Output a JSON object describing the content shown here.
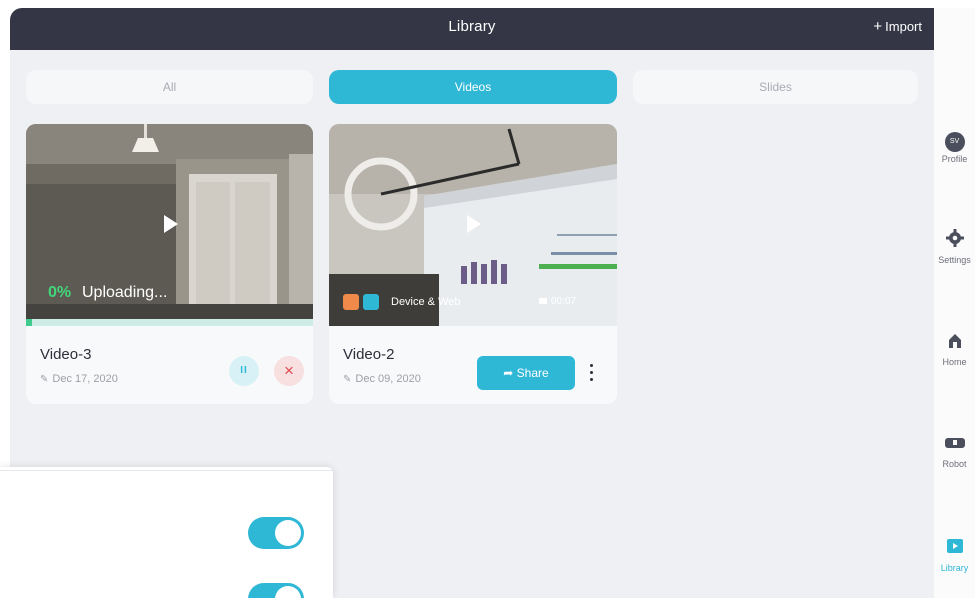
{
  "header": {
    "title": "Library",
    "import_label": "Import"
  },
  "tabs": [
    {
      "label": "All",
      "active": false
    },
    {
      "label": "Videos",
      "active": true
    },
    {
      "label": "Slides",
      "active": false
    }
  ],
  "videos": [
    {
      "name": "Video-3",
      "date": "Dec 17, 2020",
      "upload_percent": "0%",
      "upload_status": "Uploading...",
      "progress": 0.02
    },
    {
      "name": "Video-2",
      "date": "Dec 09, 2020",
      "source": "Device & Web",
      "duration": "00:07",
      "share_label": "Share"
    }
  ],
  "nav": [
    {
      "label": "Profile",
      "icon": "avatar",
      "initials": "SV"
    },
    {
      "label": "Settings",
      "icon": "gear-icon"
    },
    {
      "label": "Home",
      "icon": "home-icon"
    },
    {
      "label": "Robot",
      "icon": "robot-icon"
    },
    {
      "label": "Library",
      "icon": "library-icon",
      "active": true
    }
  ],
  "panel": {
    "toggles": [
      true,
      true
    ]
  },
  "colors": {
    "accent": "#2fb7d6",
    "header": "#343645",
    "danger": "#e0474f",
    "success": "#42d77a"
  }
}
